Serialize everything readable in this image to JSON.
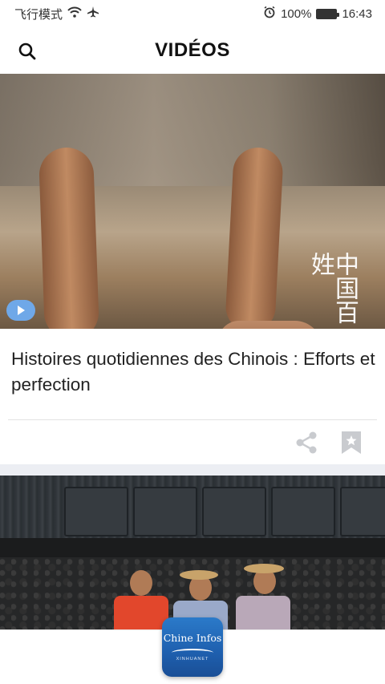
{
  "status_bar": {
    "carrier": "飞行模式",
    "battery": "100%",
    "battery_level": 1.0,
    "time": "16:43"
  },
  "header": {
    "title": "VIDÉOS"
  },
  "feed": [
    {
      "title": "Histoires quotidiennes des Chinois : Efforts et perfection",
      "watermark": "中国百姓"
    }
  ],
  "app_icon": {
    "label": "Chine Infos",
    "sublabel": "XINHUANET"
  },
  "colors": {
    "play_button": "#6fa8e8",
    "app_icon": "#1e5fae",
    "divider": "#e2e2e2"
  }
}
